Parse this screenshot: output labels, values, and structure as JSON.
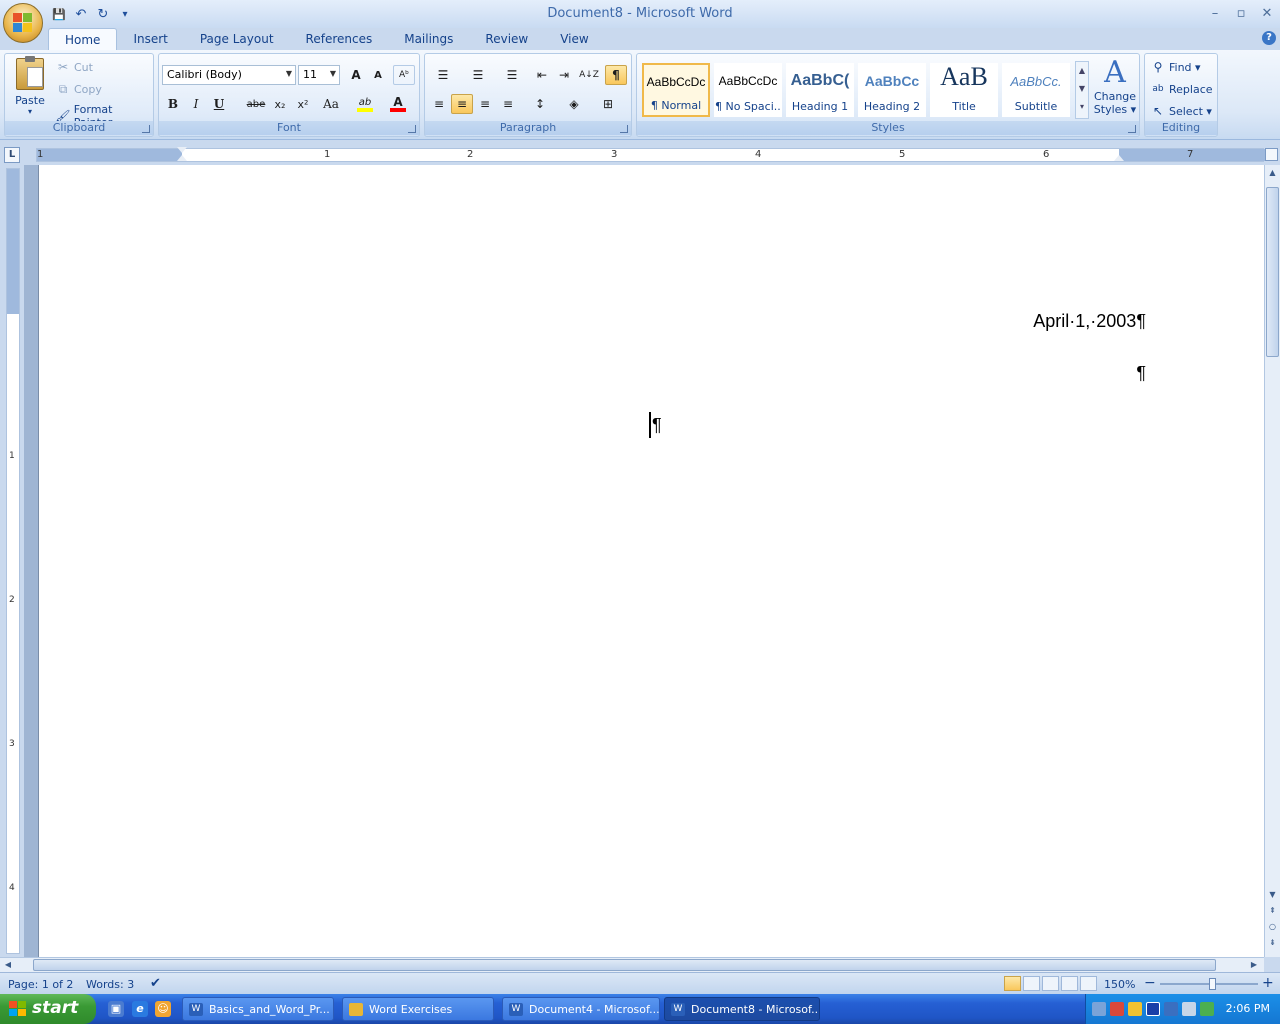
{
  "window": {
    "title": "Document8 - Microsoft Word",
    "controls": {
      "minimize": "–",
      "restore": "▫",
      "close": "✕"
    }
  },
  "quick_access": {
    "save": "💾",
    "undo": "↶",
    "redo": "↻",
    "customize": "▾"
  },
  "tabs": [
    "Home",
    "Insert",
    "Page Layout",
    "References",
    "Mailings",
    "Review",
    "View"
  ],
  "help": "?",
  "ribbon": {
    "clipboard": {
      "label": "Clipboard",
      "paste": "Paste",
      "cut": "Cut",
      "copy": "Copy",
      "format_painter": "Format Painter"
    },
    "font": {
      "label": "Font",
      "family": "Calibri (Body)",
      "size": "11",
      "grow": "A",
      "shrink": "A",
      "clear": "Aᵇ",
      "bold": "B",
      "italic": "I",
      "underline": "U",
      "strikethrough": "abe",
      "subscript": "x₂",
      "superscript": "x²",
      "change_case": "Aa",
      "highlight": "ab",
      "font_color": "A",
      "highlight_color": "#ffff00",
      "font_color_swatch": "#ff0000"
    },
    "paragraph": {
      "label": "Paragraph",
      "bullets": "☰",
      "numbering": "☰",
      "multilevel": "☰",
      "decrease_indent": "⇤",
      "increase_indent": "⇥",
      "sort": "A↓Z",
      "show_hide": "¶",
      "align_left": "≡",
      "center": "≡",
      "align_right": "≡",
      "justify": "≡",
      "line_spacing": "↕",
      "shading": "◈",
      "borders": "⊞"
    },
    "styles": {
      "label": "Styles",
      "items": [
        {
          "sample": "AaBbCcDc",
          "name": "¶ Normal"
        },
        {
          "sample": "AaBbCcDc",
          "name": "¶ No Spaci..."
        },
        {
          "sample": "AaBbC(",
          "name": "Heading 1"
        },
        {
          "sample": "AaBbCc",
          "name": "Heading 2"
        },
        {
          "sample": "AaB",
          "name": "Title"
        },
        {
          "sample": "AaBbCc.",
          "name": "Subtitle"
        }
      ],
      "change_styles_line1": "Change",
      "change_styles_line2": "Styles ▾"
    },
    "editing": {
      "label": "Editing",
      "find": "Find ▾",
      "replace": "Replace",
      "select": "Select ▾"
    }
  },
  "ruler": {
    "corner": "L",
    "numbers": [
      "1",
      "1",
      "2",
      "3",
      "4",
      "5",
      "6",
      "7"
    ],
    "vnumbers": [
      "1",
      "2",
      "3",
      "4"
    ]
  },
  "document": {
    "paragraphs": [
      "April·1,·2003¶",
      "¶",
      "¶"
    ]
  },
  "status": {
    "page": "Page: 1 of 2",
    "words": "Words: 3",
    "zoom": "150%",
    "zoom_minus": "−",
    "zoom_plus": "+"
  },
  "taskbar": {
    "start": "start",
    "tasks": [
      {
        "label": "Basics_and_Word_Pr...",
        "icon": "W",
        "color": "#2a5fb8"
      },
      {
        "label": "Word Exercises",
        "icon": "📁",
        "color": "#e8b636"
      },
      {
        "label": "Document4 - Microsof...",
        "icon": "W",
        "color": "#2a5fb8"
      },
      {
        "label": "Document8 - Microsof...",
        "icon": "W",
        "color": "#2a5fb8"
      }
    ],
    "clock": "2:06 PM"
  }
}
